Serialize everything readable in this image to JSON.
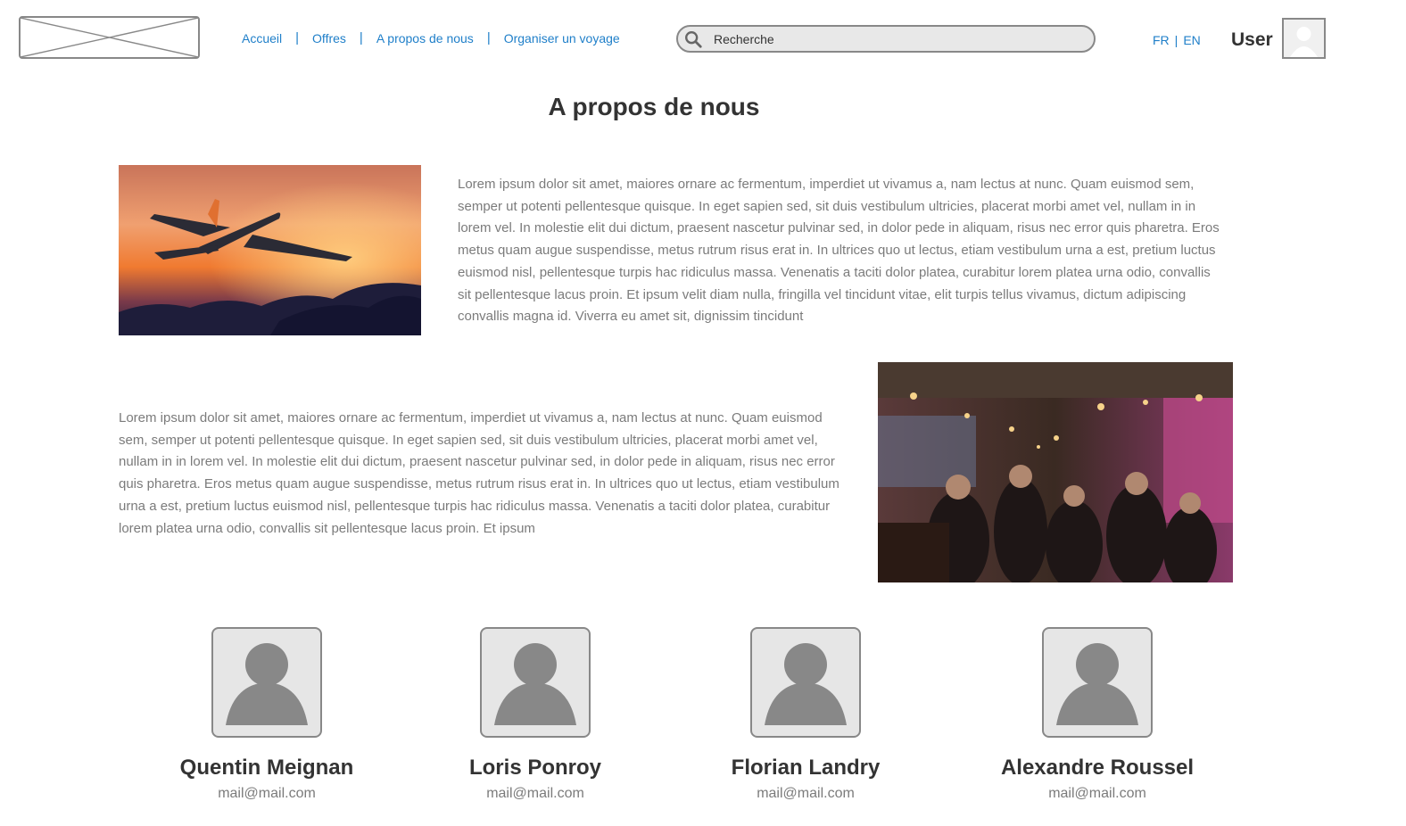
{
  "header": {
    "logo_alt": "",
    "nav": [
      {
        "label": "Accueil"
      },
      {
        "label": "Offres"
      },
      {
        "label": "A propos de nous"
      },
      {
        "label": "Organiser un voyage"
      }
    ],
    "nav_separator": "|",
    "search": {
      "placeholder": "Recherche"
    },
    "languages": [
      {
        "label": "FR"
      },
      {
        "label": "EN"
      }
    ],
    "lang_separator": "|",
    "user_label": "User"
  },
  "main": {
    "title": "A propos de nous",
    "section1_text": "Lorem ipsum dolor sit amet, maiores ornare ac fermentum, imperdiet ut vivamus a, nam lectus at nunc. Quam euismod sem, semper ut potenti pellentesque quisque. In eget sapien sed, sit duis vestibulum ultricies, placerat morbi amet vel, nullam in in lorem vel. In molestie elit dui dictum, praesent nascetur pulvinar sed, in dolor pede in aliquam, risus nec error quis pharetra. Eros metus quam augue suspendisse, metus rutrum risus erat in.  In ultrices quo ut lectus, etiam vestibulum urna a est, pretium luctus euismod nisl, pellentesque turpis hac ridiculus massa. Venenatis a taciti dolor platea, curabitur lorem platea urna odio, convallis sit pellentesque lacus proin. Et ipsum velit diam nulla, fringilla vel tincidunt vitae, elit turpis tellus vivamus, dictum adipiscing convallis magna id. Viverra eu amet sit, dignissim tincidunt",
    "section2_text": "Lorem ipsum dolor sit amet, maiores ornare ac fermentum, imperdiet ut vivamus a, nam lectus at nunc. Quam euismod sem, semper ut potenti pellentesque quisque. In eget sapien sed, sit duis vestibulum ultricies, placerat morbi amet vel, nullam in in lorem vel. In molestie elit dui dictum, praesent nascetur pulvinar sed, in dolor pede in aliquam, risus nec error quis pharetra. Eros metus quam augue suspendisse, metus rutrum risus erat in.  In ultrices quo ut lectus, etiam vestibulum urna a est, pretium luctus euismod nisl, pellentesque turpis hac ridiculus massa. Venenatis a taciti dolor platea, curabitur lorem platea urna odio, convallis sit pellentesque lacus proin. Et ipsum",
    "team": [
      {
        "name": "Quentin Meignan",
        "email": "mail@mail.com"
      },
      {
        "name": "Loris Ponroy",
        "email": "mail@mail.com"
      },
      {
        "name": "Florian Landry",
        "email": "mail@mail.com"
      },
      {
        "name": "Alexandre Roussel",
        "email": "mail@mail.com"
      }
    ]
  },
  "colors": {
    "link": "#1f7fc9",
    "text": "#333333",
    "muted": "#7b7b7b",
    "border": "#888888"
  }
}
